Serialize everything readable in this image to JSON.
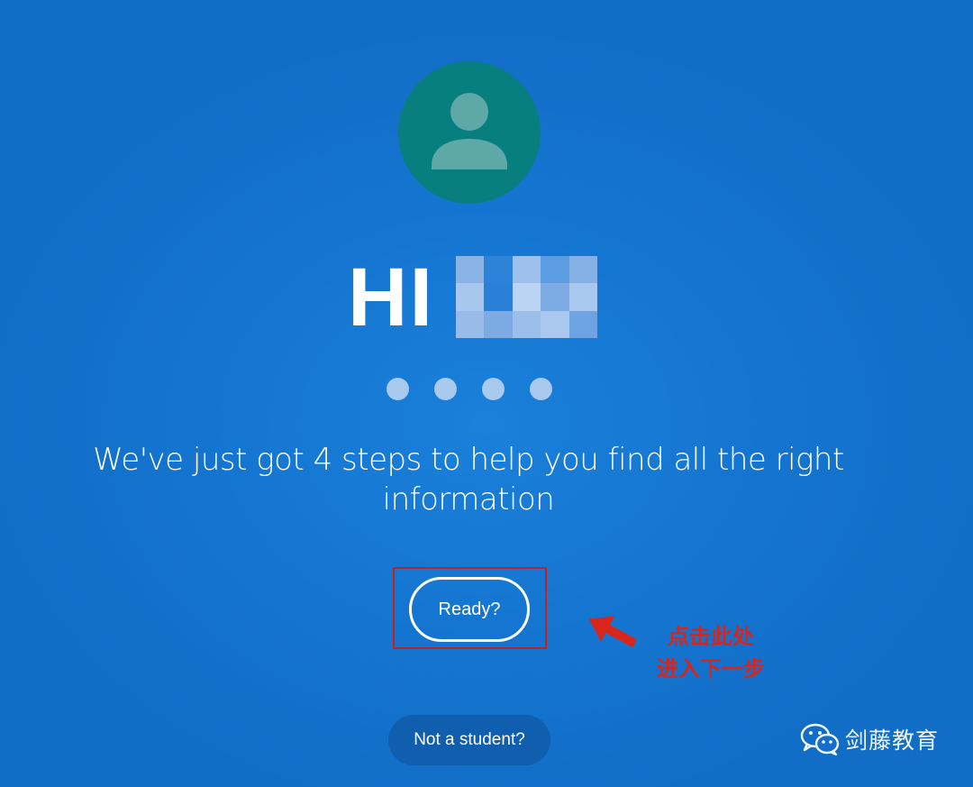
{
  "greeting": {
    "text": "HI",
    "name_redacted": true
  },
  "progress": {
    "total_steps": 4,
    "current_step": 0
  },
  "intro": {
    "message": "We've just got 4 steps to help you find all the right information"
  },
  "ready_button": {
    "label": "Ready?"
  },
  "secondary_button": {
    "label": "Not a student?"
  },
  "annotation": {
    "line1": "点击此处",
    "line2": "进入下一步",
    "color": "#d9261c"
  },
  "watermark": {
    "text": "剑藤教育",
    "icon": "wechat-icon"
  },
  "colors": {
    "background": "#1475d0",
    "avatar": "#087f7f",
    "avatar_figure": "#5ea8a8",
    "dot": "#a9c9ef",
    "secondary_button": "#0f5fae"
  }
}
